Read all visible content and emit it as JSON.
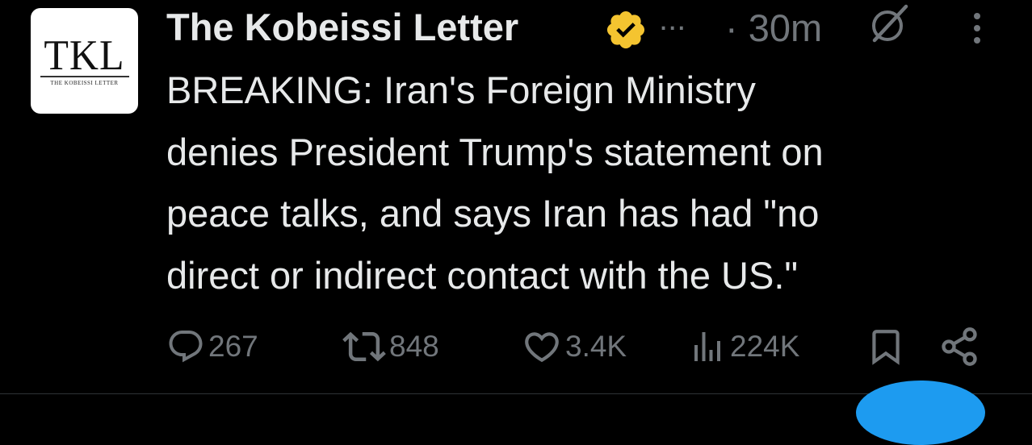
{
  "author": {
    "avatar_monogram": "TKL",
    "avatar_subtext": "THE KOBEISSI LETTER",
    "name": "The Kobeissi Letter",
    "verified_badge_color": "#f4c430",
    "truncation": "...",
    "time": "· 30m"
  },
  "icons": {
    "verified": "verified-badge-icon",
    "grok": "grok-icon",
    "more": "more-vertical-icon",
    "reply": "reply-icon",
    "retweet": "retweet-icon",
    "like": "heart-icon",
    "views": "views-bar-icon",
    "bookmark": "bookmark-icon",
    "share": "share-icon"
  },
  "tweet": {
    "text": "BREAKING: Iran's Foreign Ministry\ndenies President Trump's statement on\npeace talks, and says Iran has had \"no\ndirect or indirect contact with the US.\""
  },
  "actions": {
    "replies": "267",
    "retweets": "848",
    "likes": "3.4K",
    "views": "224K"
  },
  "colors": {
    "background": "#000000",
    "text": "#e7e9ea",
    "muted": "#71767b",
    "accent": "#1d9bf0"
  }
}
